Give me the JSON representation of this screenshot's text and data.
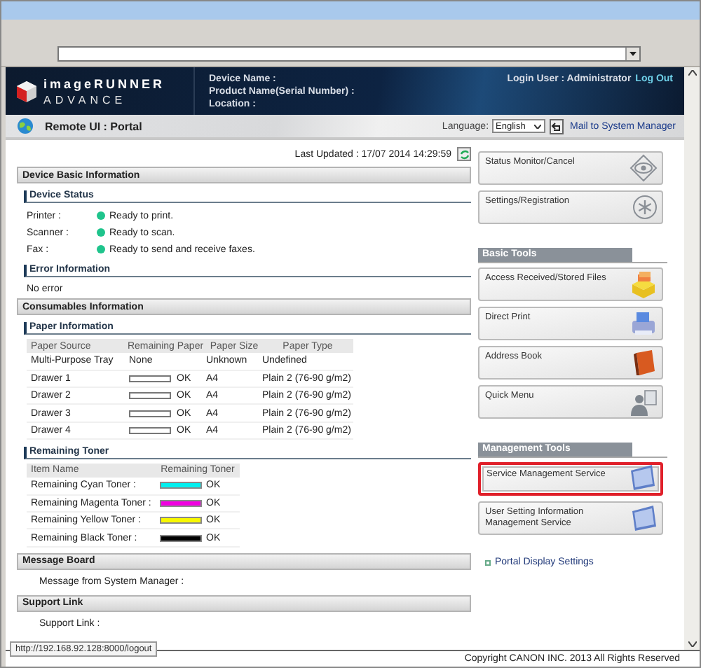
{
  "header": {
    "brand": "imageRUNNER",
    "brand_sub": "ADVANCE",
    "device_fields": [
      "Device Name :",
      "Product Name(Serial Number) :",
      "Location :"
    ],
    "login_user": "Login User : Administrator",
    "logout": "Log Out"
  },
  "portal_bar": {
    "title": "Remote UI : Portal",
    "language_label": "Language:",
    "language": "English",
    "mail_link": "Mail to System Manager"
  },
  "last_updated": "Last Updated : 17/07 2014 14:29:59",
  "device_basic": {
    "title": "Device Basic Information",
    "status_title": "Device Status",
    "statuses": [
      {
        "label": "Printer :",
        "text": "Ready to print.",
        "color": "#1fc48c"
      },
      {
        "label": "Scanner :",
        "text": "Ready to scan.",
        "color": "#1fc48c"
      },
      {
        "label": "Fax :",
        "text": "Ready to send and receive faxes.",
        "color": "#1fc48c"
      }
    ],
    "error_title": "Error Information",
    "error_text": "No error"
  },
  "consumables": {
    "title": "Consumables Information",
    "paper_title": "Paper Information",
    "paper_columns": [
      "Paper Source",
      "Remaining Paper",
      "Paper Size",
      "Paper Type"
    ],
    "paper_rows": [
      {
        "source": "Multi-Purpose Tray",
        "kind": "text",
        "remaining": "None",
        "size": "Unknown",
        "type": "Undefined"
      },
      {
        "source": "Drawer 1",
        "kind": "gauge",
        "remaining": "OK",
        "size": "A4",
        "type": "Plain 2 (76-90 g/m2)"
      },
      {
        "source": "Drawer 2",
        "kind": "gauge",
        "remaining": "OK",
        "size": "A4",
        "type": "Plain 2 (76-90 g/m2)"
      },
      {
        "source": "Drawer 3",
        "kind": "gauge",
        "remaining": "OK",
        "size": "A4",
        "type": "Plain 2 (76-90 g/m2)"
      },
      {
        "source": "Drawer 4",
        "kind": "gauge",
        "remaining": "OK",
        "size": "A4",
        "type": "Plain 2 (76-90 g/m2)"
      }
    ],
    "toner_title": "Remaining Toner",
    "toner_columns": [
      "Item Name",
      "Remaining Toner"
    ],
    "toners": [
      {
        "name": "Remaining Cyan Toner :",
        "color": "#00f0f0",
        "reading": "OK"
      },
      {
        "name": "Remaining Magenta Toner :",
        "color": "#f000e0",
        "reading": "OK"
      },
      {
        "name": "Remaining Yellow Toner :",
        "color": "#f8f800",
        "reading": "OK"
      },
      {
        "name": "Remaining Black Toner :",
        "color": "#000000",
        "reading": "OK"
      }
    ]
  },
  "message_board": {
    "title": "Message Board",
    "text": "Message from System Manager :"
  },
  "support": {
    "title": "Support Link",
    "text": "Support Link :"
  },
  "tool_groups": [
    {
      "buttons": [
        {
          "label": "Status Monitor/Cancel",
          "kind": "eye",
          "selected": false
        },
        {
          "label": "Settings/Registration",
          "kind": "asterisk",
          "selected": false
        }
      ]
    },
    {
      "title": "Basic Tools",
      "buttons": [
        {
          "label": "Access Received/Stored Files",
          "kind": "files",
          "selected": false
        },
        {
          "label": "Direct Print",
          "kind": "printer",
          "selected": false
        },
        {
          "label": "Address Book",
          "kind": "book",
          "selected": false
        },
        {
          "label": "Quick Menu",
          "kind": "person",
          "selected": false
        }
      ]
    },
    {
      "title": "Management Tools",
      "buttons": [
        {
          "label": "Service Management Service",
          "kind": "monitor",
          "selected": true
        },
        {
          "label": "User Setting Information Management Service",
          "kind": "monitor",
          "selected": false
        }
      ]
    }
  ],
  "portal_settings": "Portal Display Settings",
  "copyright": "Copyright CANON INC. 2013 All Rights Reserved",
  "status_url": "http://192.168.92.128:8000/logout"
}
